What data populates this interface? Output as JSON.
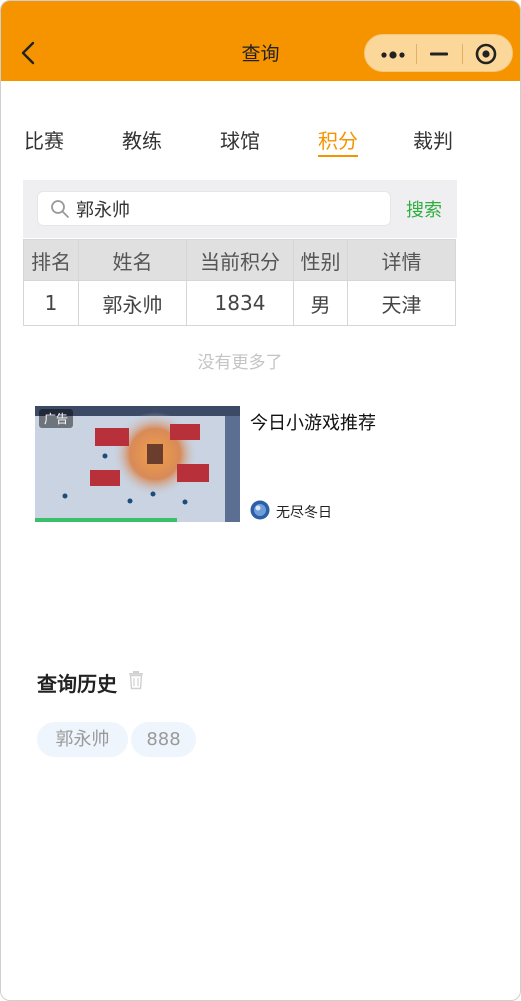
{
  "header": {
    "title": "查询"
  },
  "tabs": [
    {
      "label": "比赛",
      "active": false
    },
    {
      "label": "教练",
      "active": false
    },
    {
      "label": "球馆",
      "active": false
    },
    {
      "label": "积分",
      "active": true
    },
    {
      "label": "裁判",
      "active": false
    }
  ],
  "search": {
    "value": "郭永帅",
    "button_label": "搜索"
  },
  "table": {
    "headers": [
      "排名",
      "姓名",
      "当前积分",
      "性别",
      "详情"
    ],
    "rows": [
      [
        "1",
        "郭永帅",
        "1834",
        "男",
        "天津"
      ]
    ]
  },
  "no_more_text": "没有更多了",
  "ad": {
    "badge": "广告",
    "title": "今日小游戏推荐",
    "game_name": "无尽冬日"
  },
  "history": {
    "title": "查询历史",
    "items": [
      "郭永帅",
      "888"
    ]
  },
  "colors": {
    "accent": "#f69400",
    "search_button": "#2fae3d"
  }
}
